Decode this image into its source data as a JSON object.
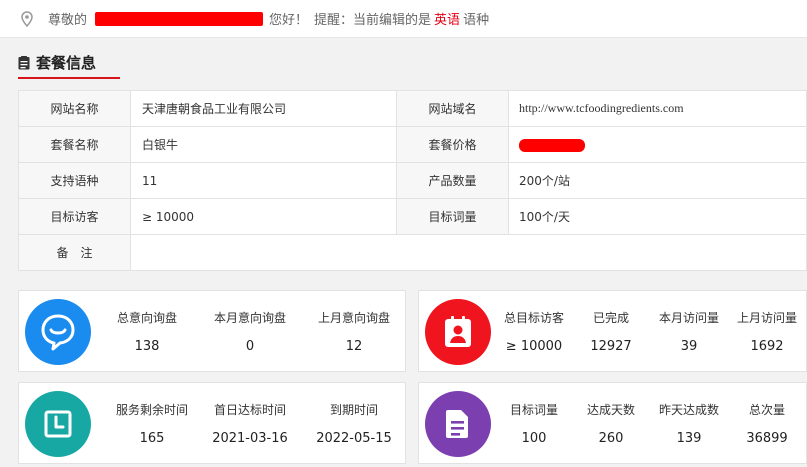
{
  "topbar": {
    "greeting": "尊敬的",
    "hello": "您好！",
    "reminder": "提醒：当前编辑的是",
    "language": "英语",
    "suffix": "语种",
    "accent_color": "#e60012"
  },
  "section": {
    "title": "套餐信息",
    "icon": "document-icon"
  },
  "info": {
    "site_name_label": "网站名称",
    "site_name": "天津唐朝食品工业有限公司",
    "domain_label": "网站域名",
    "domain": "http://www.tcfoodingredients.com",
    "package_label": "套餐名称",
    "package": "白银牛",
    "price_label": "套餐价格",
    "lang_label": "支持语种",
    "lang_count": "11",
    "product_label": "产品数量",
    "product_count": "200个/站",
    "visitor_label": "目标访客",
    "visitor_target": "≥ 10000",
    "keyword_label": "目标词量",
    "keyword_target": "100个/天",
    "remark_label": "备　注"
  },
  "cards": {
    "inquiry": {
      "icon": "chat-bubble-icon",
      "color": "#1a8cf0",
      "stats": [
        {
          "label": "总意向询盘",
          "value": "138"
        },
        {
          "label": "本月意向询盘",
          "value": "0"
        },
        {
          "label": "上月意向询盘",
          "value": "12"
        }
      ]
    },
    "visitors": {
      "icon": "contact-card-icon",
      "color": "#f0141e",
      "stats": [
        {
          "label": "总目标访客",
          "value": "≥ 10000"
        },
        {
          "label": "已完成",
          "value": "12927"
        },
        {
          "label": "本月访问量",
          "value": "39"
        },
        {
          "label": "上月访问量",
          "value": "1692"
        }
      ]
    },
    "service": {
      "icon": "clock-icon",
      "color": "#17a8a4",
      "stats": [
        {
          "label": "服务剩余时间",
          "value": "165"
        },
        {
          "label": "首日达标时间",
          "value": "2021-03-16"
        },
        {
          "label": "到期时间",
          "value": "2022-05-15"
        }
      ]
    },
    "keywords": {
      "icon": "document-icon",
      "color": "#7b3fb0",
      "stats": [
        {
          "label": "目标词量",
          "value": "100"
        },
        {
          "label": "达成天数",
          "value": "260"
        },
        {
          "label": "昨天达成数",
          "value": "139"
        },
        {
          "label": "总次量",
          "value": "36899"
        }
      ]
    }
  }
}
